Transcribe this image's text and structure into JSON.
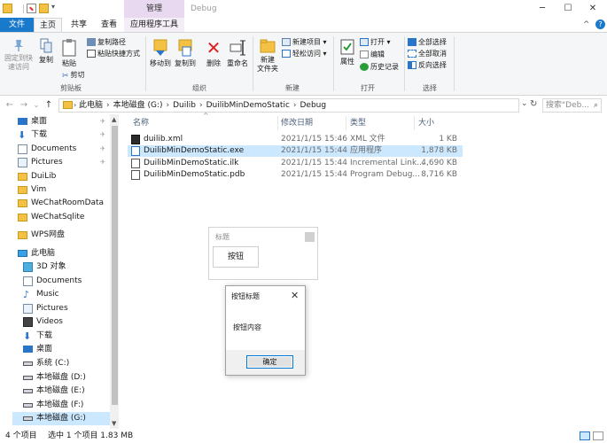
{
  "window": {
    "title": "Debug",
    "context_tab_header": "管理",
    "minimize": "─",
    "maximize": "☐",
    "close": "✕",
    "help": "?",
    "collapse": "^"
  },
  "tabs": {
    "file": "文件",
    "home": "主页",
    "share": "共享",
    "view": "查看",
    "app_tools": "应用程序工具"
  },
  "ribbon": {
    "clipboard": {
      "label": "剪贴板",
      "pin_quick_access_1": "固定到快",
      "pin_quick_access_2": "速访问",
      "copy": "复制",
      "paste": "粘贴",
      "copy_path": "复制路径",
      "paste_shortcut": "粘贴快捷方式",
      "cut": "剪切"
    },
    "organize": {
      "label": "组织",
      "move_to": "移动到",
      "copy_to": "复制到",
      "delete": "删除",
      "rename": "重命名"
    },
    "new": {
      "label": "新建",
      "new_folder_1": "新建",
      "new_folder_2": "文件夹",
      "new_item": "新建项目 ▾",
      "easy_access": "轻松访问 ▾"
    },
    "open": {
      "label": "打开",
      "properties": "属性",
      "open": "打开 ▾",
      "edit": "编辑",
      "history": "历史记录"
    },
    "select": {
      "label": "选择",
      "select_all": "全部选择",
      "select_none": "全部取消",
      "invert": "反向选择"
    }
  },
  "address": {
    "back": "←",
    "forward": "→",
    "recent": "⌄",
    "up": "↑",
    "breadcrumbs": [
      "此电脑",
      "本地磁盘 (G:)",
      "Duilib",
      "DuilibMinDemoStatic",
      "Debug"
    ],
    "dropdown": "⌄",
    "refresh": "↻",
    "search_placeholder": "搜索\"Deb...",
    "search_icon": "⌕"
  },
  "nav": {
    "items": [
      {
        "label": "桌面",
        "pinned": true
      },
      {
        "label": "下载",
        "pinned": true
      },
      {
        "label": "Documents",
        "pinned": true
      },
      {
        "label": "Pictures",
        "pinned": true
      },
      {
        "label": "DuiLib",
        "pinned": false
      },
      {
        "label": "Vim",
        "pinned": false
      },
      {
        "label": "WeChatRoomData",
        "pinned": false
      },
      {
        "label": "WeChatSqlite",
        "pinned": false
      },
      {
        "label": "WPS网盘",
        "pinned": false
      },
      {
        "label": "此电脑",
        "pinned": false
      },
      {
        "label": "3D 对象",
        "pinned": false
      },
      {
        "label": "Documents",
        "pinned": false
      },
      {
        "label": "Music",
        "pinned": false
      },
      {
        "label": "Pictures",
        "pinned": false
      },
      {
        "label": "Videos",
        "pinned": false
      },
      {
        "label": "下载",
        "pinned": false
      },
      {
        "label": "桌面",
        "pinned": false
      },
      {
        "label": "系统 (C:)",
        "pinned": false
      },
      {
        "label": "本地磁盘 (D:)",
        "pinned": false
      },
      {
        "label": "本地磁盘 (E:)",
        "pinned": false
      },
      {
        "label": "本地磁盘 (F:)",
        "pinned": false
      },
      {
        "label": "本地磁盘 (G:)",
        "pinned": false
      }
    ],
    "pin_glyph": "✈"
  },
  "columns": {
    "name": "名称",
    "date": "修改日期",
    "type": "类型",
    "size": "大小",
    "sort_arrow": "^"
  },
  "files": [
    {
      "name": "duilib.xml",
      "date": "2021/1/15 15:46",
      "type": "XML 文件",
      "size": "1 KB",
      "icon": "xml-icon",
      "selected": false
    },
    {
      "name": "DuilibMinDemoStatic.exe",
      "date": "2021/1/15 15:44",
      "type": "应用程序",
      "size": "1,878 KB",
      "icon": "exe-icon",
      "selected": true
    },
    {
      "name": "DuilibMinDemoStatic.ilk",
      "date": "2021/1/15 15:44",
      "type": "Incremental Link...",
      "size": "4,690 KB",
      "icon": "ilk-icon",
      "selected": false
    },
    {
      "name": "DuilibMinDemoStatic.pdb",
      "date": "2021/1/15 15:44",
      "type": "Program Debug...",
      "size": "8,716 KB",
      "icon": "pdb-icon",
      "selected": false
    }
  ],
  "status": {
    "count": "4 个项目",
    "selection": "选中 1 个项目  1.83 MB"
  },
  "mini_window": {
    "title": "标题",
    "button": "按钮"
  },
  "message_box": {
    "title": "按钮标题",
    "body": "按钮内容",
    "ok": "确定",
    "close": "✕"
  },
  "colors": {
    "accent": "#1979ca",
    "selection": "#cce8ff",
    "context_tab": "#e8d9f0"
  }
}
